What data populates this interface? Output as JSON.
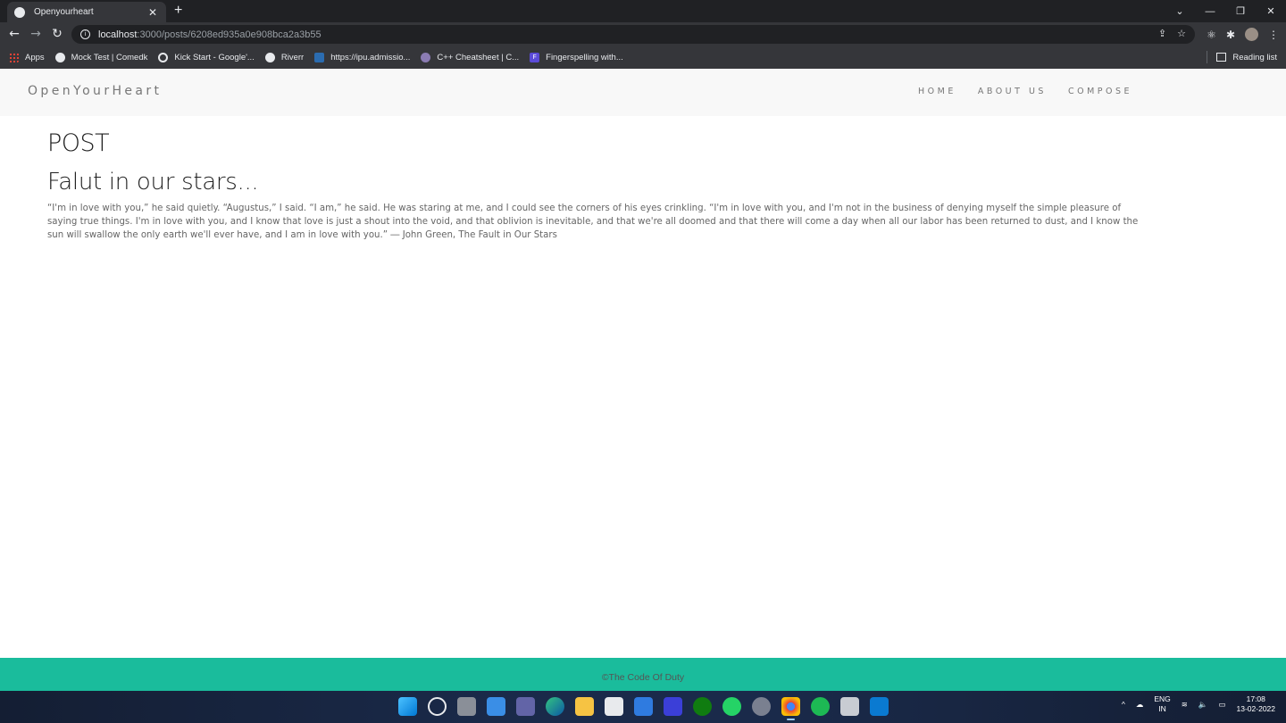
{
  "browser": {
    "tab_title": "Openyourheart",
    "url_host": "localhost",
    "url_path": ":3000/posts/6208ed935a0e908bca2a3b55",
    "window_controls": [
      "⌄",
      "—",
      "❐",
      "✕"
    ],
    "bookmarks": [
      {
        "label": "Apps",
        "icon": "apps-grid-icon"
      },
      {
        "label": "Mock Test | Comedk",
        "icon": "globe-icon"
      },
      {
        "label": "Kick Start - Google'...",
        "icon": "google-icon"
      },
      {
        "label": "Riverr",
        "icon": "globe-icon"
      },
      {
        "label": "https://ipu.admissio...",
        "icon": "ipu-icon"
      },
      {
        "label": "C++ Cheatsheet | C...",
        "icon": "cpp-icon"
      },
      {
        "label": "Fingerspelling with...",
        "icon": "f-icon"
      }
    ],
    "reading_list": "Reading list"
  },
  "site": {
    "brand": "OpenYourHeart",
    "nav": [
      "HOME",
      "ABOUT US",
      "COMPOSE"
    ]
  },
  "post": {
    "heading": "POST",
    "title": "Falut in our stars...",
    "body": "“I'm in love with you,” he said quietly. “Augustus,” I said. “I am,” he said. He was staring at me, and I could see the corners of his eyes crinkling. “I'm in love with you, and I'm not in the business of denying myself the simple pleasure of saying true things. I'm in love with you, and I know that love is just a shout into the void, and that oblivion is inevitable, and that we're all doomed and that there will come a day when all our labor has been returned to dust, and I know the sun will swallow the only earth we'll ever have, and I am in love with you.” ― John Green, The Fault in Our Stars"
  },
  "footer": {
    "text": "©The Code Of Duty"
  },
  "taskbar": {
    "lang_top": "ENG",
    "lang_bottom": "IN",
    "time": "17:08",
    "date": "13-02-2022",
    "colors": {
      "footer_bg": "#1abc9c",
      "navbar_bg": "#f8f8f8",
      "taskbar_bg": "#1a2a4a"
    }
  }
}
